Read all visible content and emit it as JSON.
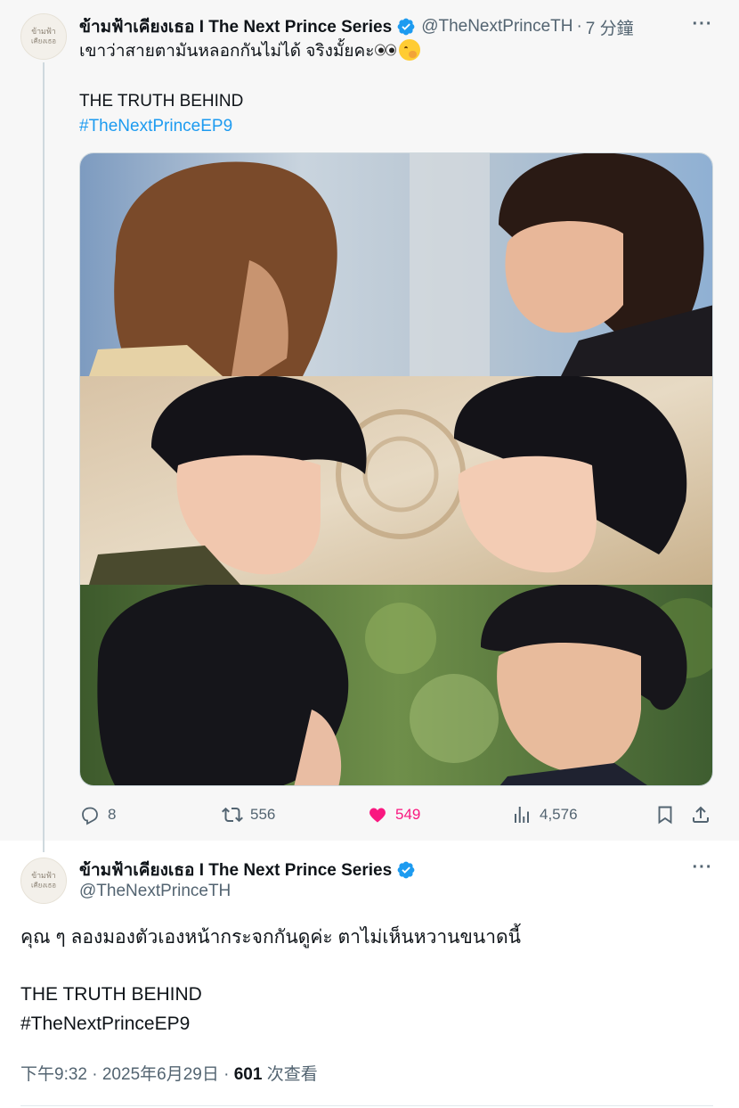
{
  "tweet1": {
    "display_name": "ข้ามฟ้าเคียงเธอ I The Next Prince Series",
    "handle": "@TheNextPrinceTH",
    "separator": "·",
    "time": "7 分鐘",
    "more": "···",
    "text_line1": "เขาว่าสายตามันหลอกกันไม่ได้ จริงมั้ยคะ",
    "text_line3": "THE TRUTH BEHIND",
    "hashtag": "#TheNextPrinceEP9",
    "actions": {
      "replies": "8",
      "reposts": "556",
      "likes": "549",
      "views": "4,576"
    },
    "colors": {
      "like": "#f91880",
      "link": "#1d9bf0",
      "muted": "#536471"
    }
  },
  "tweet2": {
    "display_name": "ข้ามฟ้าเคียงเธอ I The Next Prince Series",
    "handle": "@TheNextPrinceTH",
    "more": "···",
    "text_line1": "คุณ ๆ ลองมองตัวเองหน้ากระจกกันดูค่ะ ตาไม่เห็นหวานขนาดนี้",
    "text_line3": "THE TRUTH BEHIND",
    "hashtag": "#TheNextPrinceEP9",
    "meta_time": "下午9:32 · 2025年6月29日 · ",
    "meta_views": "601",
    "meta_views_label": " 次查看"
  },
  "avatar_logo": {
    "line1": "ข้ามฟ้า",
    "line2": "เคียงเธอ"
  }
}
